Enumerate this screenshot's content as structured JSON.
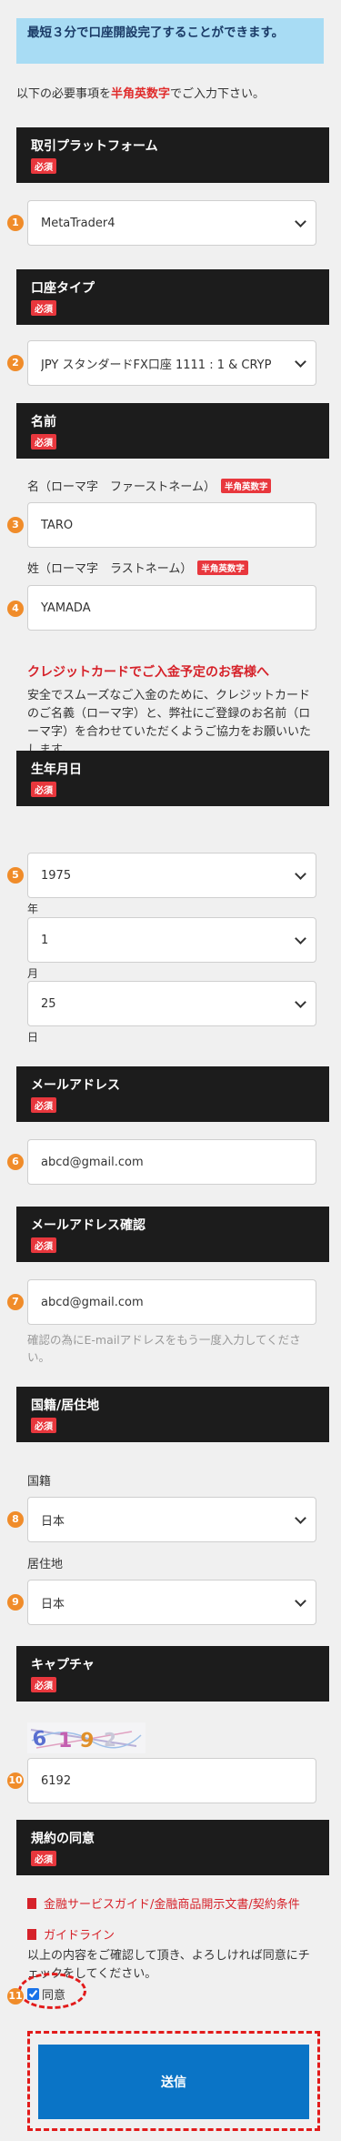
{
  "banner": "最短３分で口座開設完了することができます。",
  "intro": {
    "pre": "以下の必要事項を",
    "em": "半角英数字",
    "post": "でご入力下さい。"
  },
  "required_badge": "必須",
  "halfwidth_badge": "半角英数字",
  "numbers": [
    "1",
    "2",
    "3",
    "4",
    "5",
    "6",
    "7",
    "8",
    "9",
    "10",
    "11"
  ],
  "sections": {
    "platform": {
      "title": "取引プラットフォーム",
      "value": "MetaTrader4"
    },
    "account_type": {
      "title": "口座タイプ",
      "value": "JPY スタンダードFX口座 1111 : 1 & CRYP"
    },
    "name": {
      "title": "名前",
      "first_label": "名（ローマ字　ファーストネーム）",
      "first_value": "TARO",
      "last_label": "姓（ローマ字　ラストネーム）",
      "last_value": "YAMADA",
      "card_heading": "クレジットカードでご入金予定のお客様へ",
      "card_text": "安全でスムーズなご入金のために、クレジットカードのご名義（ローマ字）と、弊社にご登録のお名前（ローマ字）を合わせていただくようご協力をお願いいたします。"
    },
    "birthdate": {
      "title": "生年月日",
      "year": "1975",
      "year_unit": "年",
      "month": "1",
      "month_unit": "月",
      "day": "25",
      "day_unit": "日"
    },
    "email": {
      "title": "メールアドレス",
      "value": "abcd@gmail.com"
    },
    "email_confirm": {
      "title": "メールアドレス確認",
      "value": "abcd@gmail.com",
      "note": "確認の為にE-mailアドレスをもう一度入力してください。"
    },
    "nationality": {
      "title": "国籍/居住地",
      "nationality_label": "国籍",
      "nationality_value": "日本",
      "residence_label": "居住地",
      "residence_value": "日本"
    },
    "captcha": {
      "title": "キャプチャ",
      "image_text": "6192",
      "value": "6192"
    },
    "terms": {
      "title": "規約の同意",
      "link1": "金融サービスガイド/金融商品開示文書/契約条件",
      "link2": "ガイドライン",
      "text": "以上の内容をご確認して頂き、よろしければ同意にチェックをしてください。",
      "agree_label": "同意",
      "agree_checked": true
    }
  },
  "submit_label": "送信",
  "colors": {
    "accent_red": "#e8373d",
    "header_bg": "#1c1c1c",
    "submit_blue": "#0a74c6",
    "banner_bg": "#a8dcf4",
    "step_orange": "#f08c2a"
  }
}
